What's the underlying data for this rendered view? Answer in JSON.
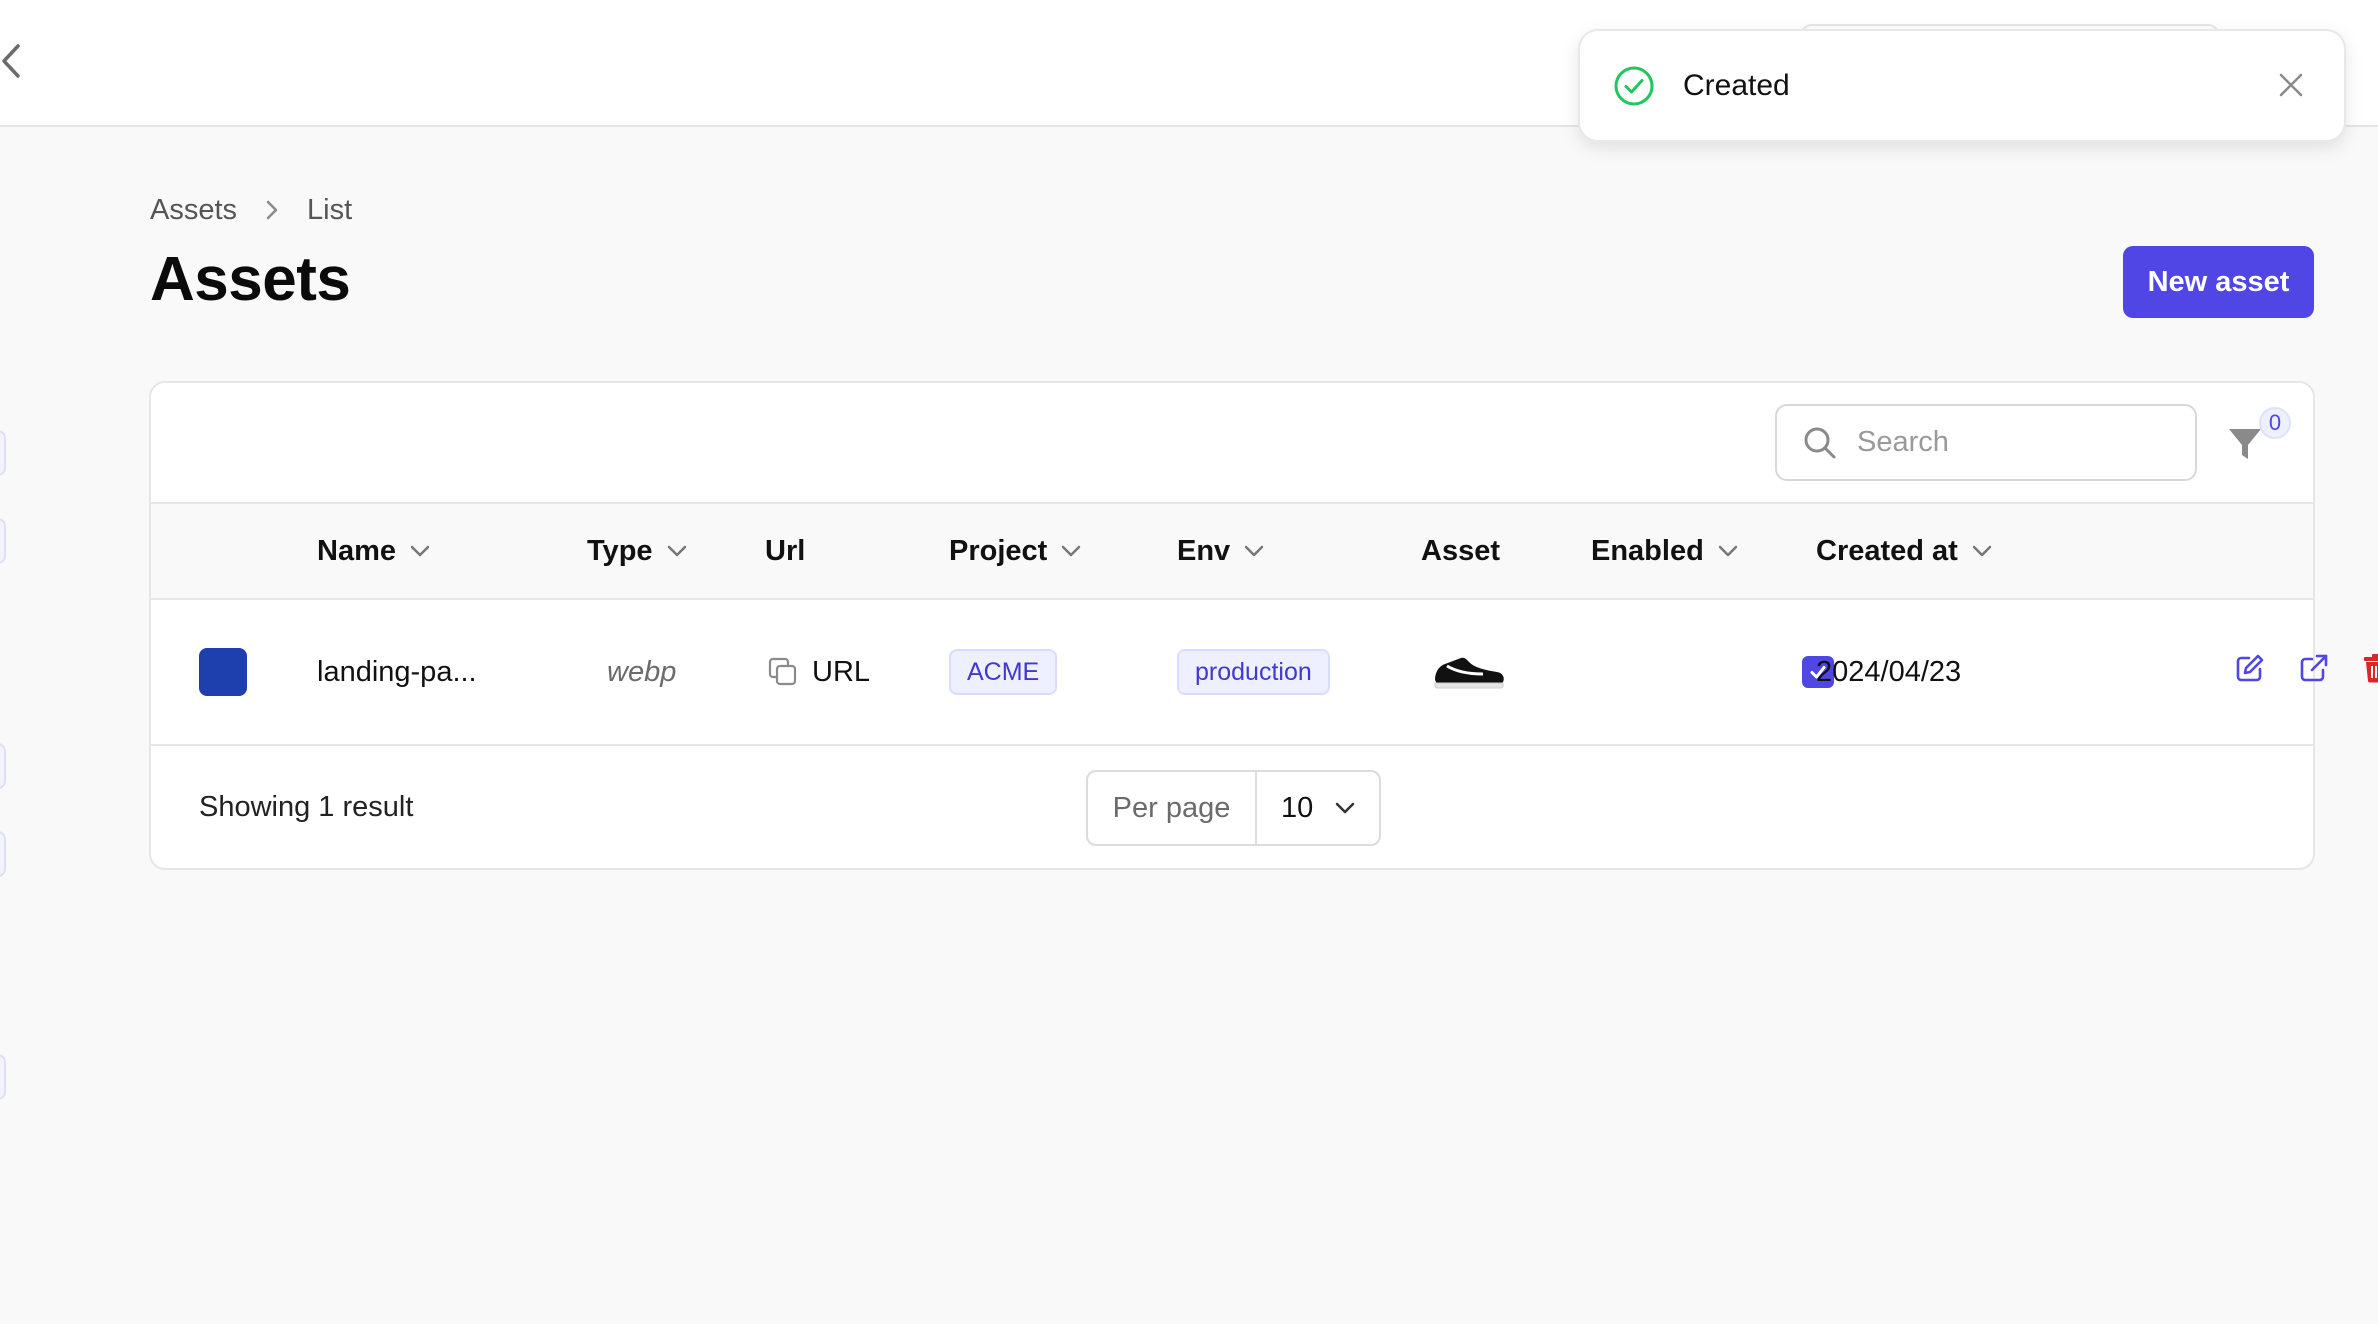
{
  "toast": {
    "message": "Created"
  },
  "breadcrumb": {
    "items": [
      "Assets",
      "List"
    ]
  },
  "page": {
    "title": "Assets",
    "new_button": "New asset"
  },
  "toolbar": {
    "search_placeholder": "Search",
    "filter_count": "0"
  },
  "table": {
    "columns": {
      "name": "Name",
      "type": "Type",
      "url": "Url",
      "project": "Project",
      "env": "Env",
      "asset": "Asset",
      "enabled": "Enabled",
      "created_at": "Created at"
    },
    "rows": [
      {
        "color": "#1e40af",
        "name": "landing-pa...",
        "type": "webp",
        "url_label": "URL",
        "project": "ACME",
        "env": "production",
        "asset_icon": "sneaker-thumbnail",
        "enabled": true,
        "created_at": "2024/04/23"
      }
    ]
  },
  "footer": {
    "result_text": "Showing 1 result",
    "per_page_label": "Per page",
    "per_page_value": "10"
  },
  "colors": {
    "accent": "#4f46e5",
    "danger": "#dc2626",
    "success": "#22c55e"
  }
}
